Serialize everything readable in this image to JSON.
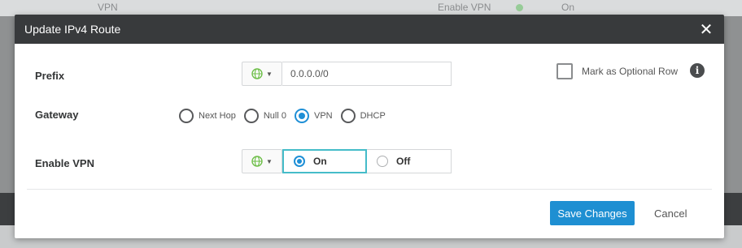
{
  "background": {
    "top_left_text": "VPN",
    "top_mid_text": "Enable VPN",
    "top_right_text": "On"
  },
  "modal": {
    "title": "Update IPv4 Route",
    "close_glyph": "✕"
  },
  "form": {
    "prefix": {
      "label": "Prefix",
      "value": "0.0.0.0/0"
    },
    "optional_row": {
      "label": "Mark as Optional Row",
      "checked": false,
      "info_glyph": "i"
    },
    "gateway": {
      "label": "Gateway",
      "options": [
        "Next Hop",
        "Null 0",
        "VPN",
        "DHCP"
      ],
      "selected": "VPN"
    },
    "enable_vpn": {
      "label": "Enable VPN",
      "on_label": "On",
      "off_label": "Off",
      "selected": "On"
    }
  },
  "footer": {
    "save_label": "Save Changes",
    "cancel_label": "Cancel"
  },
  "colors": {
    "accent": "#1e8fd2",
    "header_bg": "#383a3c",
    "selected_border": "#45bcc9",
    "globe_green": "#6fbf4a"
  },
  "icons": {
    "globe": "globe-icon",
    "caret": "caret-down-icon",
    "close": "close-icon",
    "info": "info-icon"
  }
}
